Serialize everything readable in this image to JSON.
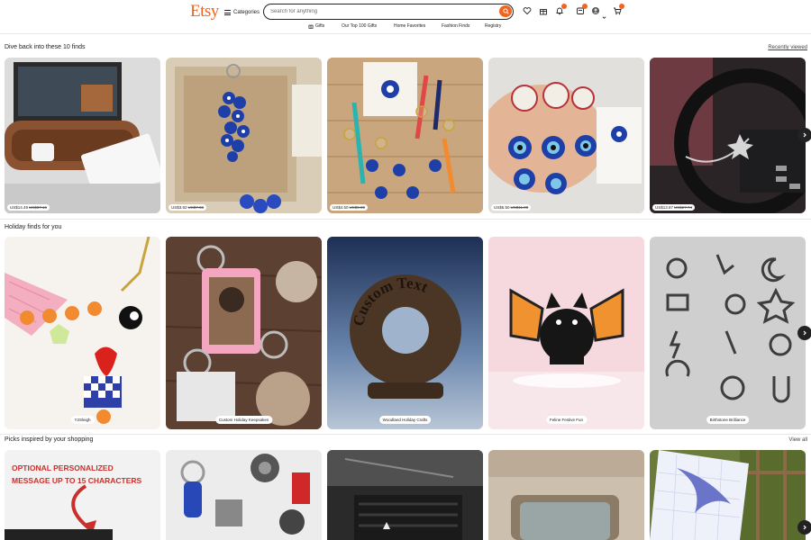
{
  "header": {
    "logo": "Etsy",
    "categories_label": "Categories",
    "search_placeholder": "Search for anything",
    "icons": [
      "search-icon",
      "heart-icon",
      "gift-icon",
      "bell-icon",
      "registry-icon",
      "account-icon",
      "cart-icon"
    ],
    "accent": "#F1641E"
  },
  "subnav": {
    "items": [
      "Gifts",
      "Our Top 100 Gifts",
      "Home Favorites",
      "Fashion Finds",
      "Registry"
    ]
  },
  "sections": [
    {
      "title": "Dive back into these 10 finds",
      "link": "Recently viewed",
      "cards": [
        {
          "price": "US$14.49",
          "old_price": "US$37.16"
        },
        {
          "price": "US$3.92",
          "old_price": "US$7.83"
        },
        {
          "price": "US$4.50",
          "old_price": "US$9.00"
        },
        {
          "price": "US$5.50",
          "old_price": "US$11.00"
        },
        {
          "price": "US$13.87",
          "old_price": "US$27.74"
        }
      ]
    },
    {
      "title": "Holiday finds for you",
      "cards": [
        {
          "label": "Y2Sleigh"
        },
        {
          "label": "Custom Holiday Keepsakes"
        },
        {
          "label": "Woodland Holiday Crafts",
          "image_text": "Custom Text"
        },
        {
          "label": "Feline Festive Fun"
        },
        {
          "label": "Birthstone Brilliance"
        }
      ]
    },
    {
      "title": "Picks inspired by your shopping",
      "link": "View all",
      "cards": [
        {
          "image_text": "OPTIONAL PERSONALIZED MESSAGE UP TO 15 CHARACTERS"
        },
        {},
        {},
        {},
        {}
      ]
    }
  ]
}
